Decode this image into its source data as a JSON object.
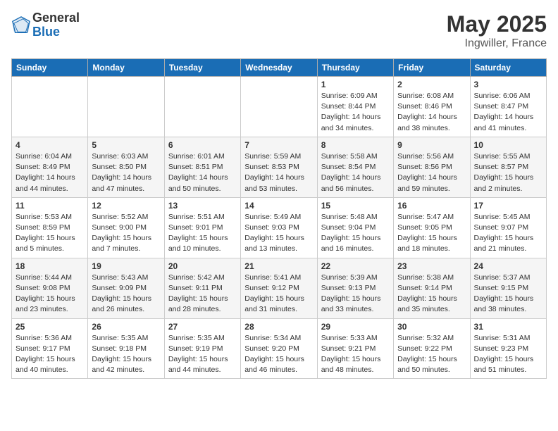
{
  "header": {
    "logo_general": "General",
    "logo_blue": "Blue",
    "month": "May 2025",
    "location": "Ingwiller, France"
  },
  "weekdays": [
    "Sunday",
    "Monday",
    "Tuesday",
    "Wednesday",
    "Thursday",
    "Friday",
    "Saturday"
  ],
  "weeks": [
    [
      {
        "day": "",
        "info": ""
      },
      {
        "day": "",
        "info": ""
      },
      {
        "day": "",
        "info": ""
      },
      {
        "day": "",
        "info": ""
      },
      {
        "day": "1",
        "info": "Sunrise: 6:09 AM\nSunset: 8:44 PM\nDaylight: 14 hours\nand 34 minutes."
      },
      {
        "day": "2",
        "info": "Sunrise: 6:08 AM\nSunset: 8:46 PM\nDaylight: 14 hours\nand 38 minutes."
      },
      {
        "day": "3",
        "info": "Sunrise: 6:06 AM\nSunset: 8:47 PM\nDaylight: 14 hours\nand 41 minutes."
      }
    ],
    [
      {
        "day": "4",
        "info": "Sunrise: 6:04 AM\nSunset: 8:49 PM\nDaylight: 14 hours\nand 44 minutes."
      },
      {
        "day": "5",
        "info": "Sunrise: 6:03 AM\nSunset: 8:50 PM\nDaylight: 14 hours\nand 47 minutes."
      },
      {
        "day": "6",
        "info": "Sunrise: 6:01 AM\nSunset: 8:51 PM\nDaylight: 14 hours\nand 50 minutes."
      },
      {
        "day": "7",
        "info": "Sunrise: 5:59 AM\nSunset: 8:53 PM\nDaylight: 14 hours\nand 53 minutes."
      },
      {
        "day": "8",
        "info": "Sunrise: 5:58 AM\nSunset: 8:54 PM\nDaylight: 14 hours\nand 56 minutes."
      },
      {
        "day": "9",
        "info": "Sunrise: 5:56 AM\nSunset: 8:56 PM\nDaylight: 14 hours\nand 59 minutes."
      },
      {
        "day": "10",
        "info": "Sunrise: 5:55 AM\nSunset: 8:57 PM\nDaylight: 15 hours\nand 2 minutes."
      }
    ],
    [
      {
        "day": "11",
        "info": "Sunrise: 5:53 AM\nSunset: 8:59 PM\nDaylight: 15 hours\nand 5 minutes."
      },
      {
        "day": "12",
        "info": "Sunrise: 5:52 AM\nSunset: 9:00 PM\nDaylight: 15 hours\nand 7 minutes."
      },
      {
        "day": "13",
        "info": "Sunrise: 5:51 AM\nSunset: 9:01 PM\nDaylight: 15 hours\nand 10 minutes."
      },
      {
        "day": "14",
        "info": "Sunrise: 5:49 AM\nSunset: 9:03 PM\nDaylight: 15 hours\nand 13 minutes."
      },
      {
        "day": "15",
        "info": "Sunrise: 5:48 AM\nSunset: 9:04 PM\nDaylight: 15 hours\nand 16 minutes."
      },
      {
        "day": "16",
        "info": "Sunrise: 5:47 AM\nSunset: 9:05 PM\nDaylight: 15 hours\nand 18 minutes."
      },
      {
        "day": "17",
        "info": "Sunrise: 5:45 AM\nSunset: 9:07 PM\nDaylight: 15 hours\nand 21 minutes."
      }
    ],
    [
      {
        "day": "18",
        "info": "Sunrise: 5:44 AM\nSunset: 9:08 PM\nDaylight: 15 hours\nand 23 minutes."
      },
      {
        "day": "19",
        "info": "Sunrise: 5:43 AM\nSunset: 9:09 PM\nDaylight: 15 hours\nand 26 minutes."
      },
      {
        "day": "20",
        "info": "Sunrise: 5:42 AM\nSunset: 9:11 PM\nDaylight: 15 hours\nand 28 minutes."
      },
      {
        "day": "21",
        "info": "Sunrise: 5:41 AM\nSunset: 9:12 PM\nDaylight: 15 hours\nand 31 minutes."
      },
      {
        "day": "22",
        "info": "Sunrise: 5:39 AM\nSunset: 9:13 PM\nDaylight: 15 hours\nand 33 minutes."
      },
      {
        "day": "23",
        "info": "Sunrise: 5:38 AM\nSunset: 9:14 PM\nDaylight: 15 hours\nand 35 minutes."
      },
      {
        "day": "24",
        "info": "Sunrise: 5:37 AM\nSunset: 9:15 PM\nDaylight: 15 hours\nand 38 minutes."
      }
    ],
    [
      {
        "day": "25",
        "info": "Sunrise: 5:36 AM\nSunset: 9:17 PM\nDaylight: 15 hours\nand 40 minutes."
      },
      {
        "day": "26",
        "info": "Sunrise: 5:35 AM\nSunset: 9:18 PM\nDaylight: 15 hours\nand 42 minutes."
      },
      {
        "day": "27",
        "info": "Sunrise: 5:35 AM\nSunset: 9:19 PM\nDaylight: 15 hours\nand 44 minutes."
      },
      {
        "day": "28",
        "info": "Sunrise: 5:34 AM\nSunset: 9:20 PM\nDaylight: 15 hours\nand 46 minutes."
      },
      {
        "day": "29",
        "info": "Sunrise: 5:33 AM\nSunset: 9:21 PM\nDaylight: 15 hours\nand 48 minutes."
      },
      {
        "day": "30",
        "info": "Sunrise: 5:32 AM\nSunset: 9:22 PM\nDaylight: 15 hours\nand 50 minutes."
      },
      {
        "day": "31",
        "info": "Sunrise: 5:31 AM\nSunset: 9:23 PM\nDaylight: 15 hours\nand 51 minutes."
      }
    ]
  ]
}
